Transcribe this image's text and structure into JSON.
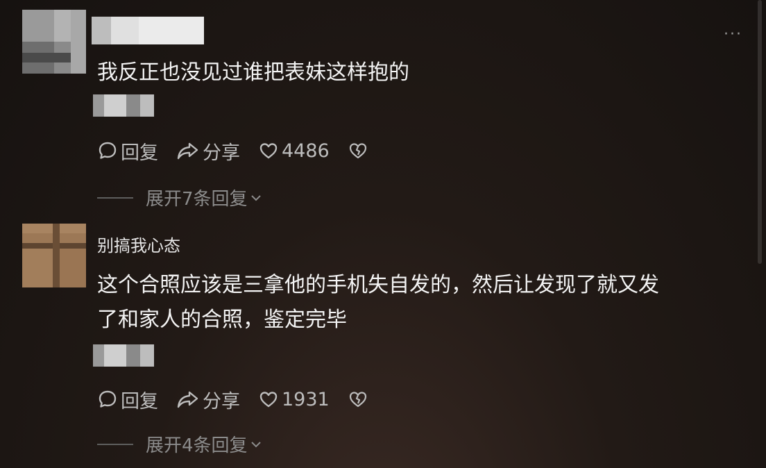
{
  "more_button": "···",
  "comments": [
    {
      "text": "我反正也没见过谁把表妹这样抱的",
      "reply_label": "回复",
      "share_label": "分享",
      "likes": "4486",
      "expand_label": "展开7条回复"
    },
    {
      "username": "别搞我心态",
      "text_line1": "这个合照应该是三拿他的手机失自发的，然后让发现了就又发",
      "text_line2": "了和家人的合照，鉴定完毕",
      "reply_label": "回复",
      "share_label": "分享",
      "likes": "1931",
      "expand_label": "展开4条回复"
    }
  ],
  "colors": {
    "background": "#1c1613",
    "text": "#f4f4f4",
    "action_text": "#bdbdbd",
    "muted": "#8c8c8c"
  }
}
